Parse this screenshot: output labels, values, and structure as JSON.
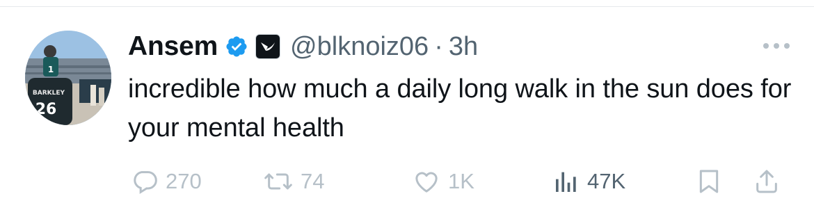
{
  "tweet": {
    "display_name": "Ansem",
    "handle": "@blknoiz06",
    "separator": "·",
    "time": "3h",
    "text": "incredible how much a daily long walk in the sun does for your mental health",
    "verified_badge_icon": "verified-check-icon",
    "affiliate_badge_icon": "affiliate-logo-icon",
    "avatar_jersey_text": "26",
    "avatar_name_text": "BARKLEY"
  },
  "actions": {
    "reply": {
      "icon": "reply-bubble-icon",
      "count": "270"
    },
    "retweet": {
      "icon": "retweet-icon",
      "count": "74"
    },
    "like": {
      "icon": "heart-icon",
      "count": "1K"
    },
    "views": {
      "icon": "views-chart-icon",
      "count": "47K"
    },
    "bookmark": {
      "icon": "bookmark-icon"
    },
    "share": {
      "icon": "share-icon"
    }
  },
  "colors": {
    "text": "#0f1419",
    "secondary": "#536471",
    "faded_action": "#b6c0c8",
    "verified_blue": "#1d9bf0",
    "divider": "#e6e9ec"
  }
}
